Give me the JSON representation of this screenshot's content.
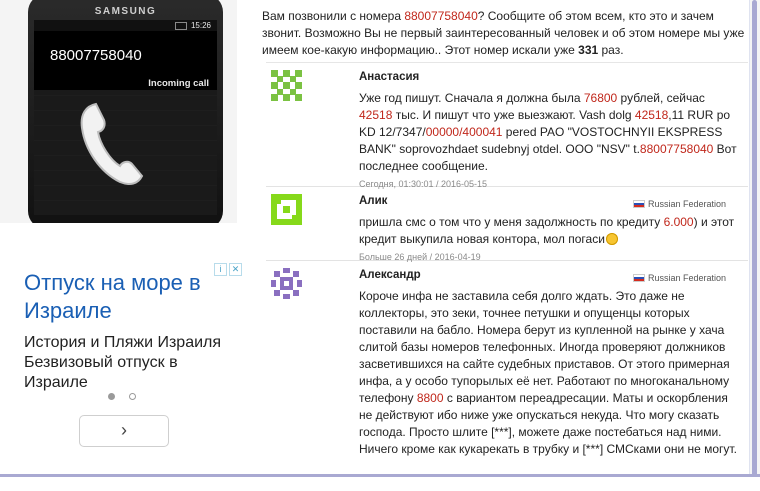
{
  "phone": {
    "brand": "SAMSUNG",
    "time": "15:26",
    "number": "88007758040",
    "status": "Incoming call"
  },
  "ad": {
    "title": "Отпуск на море в Израиле",
    "text": "История и Пляжи Израиля Безвизовый отпуск в Израиле",
    "next_label": "›",
    "dots": [
      {
        "active": true
      },
      {
        "active": false
      }
    ]
  },
  "intro": {
    "before_number": "Вам позвонили с номера ",
    "number": "88007758040",
    "after_number": "? Сообщите об этом всем, кто это и зачем звонит. Возможно Вы не первый заинтересованный человек и об этом номере мы уже имеем кое-какую информацию.. Этот номер искали уже ",
    "search_count": "331",
    "suffix": " раз."
  },
  "comments": [
    {
      "author": "Анастасия",
      "country": "",
      "text_a": "Уже год пишут. Сначала я должна была ",
      "hl1": "76800",
      "text_b": " рублей, сейчас ",
      "hl2": "42518",
      "text_c": " тыс. И пишут что уже выезжают. Vash dolg ",
      "hl3": "42518",
      "text_d": ",11 RUR po KD 12/7347/",
      "hl4": "00000/400041",
      "text_e": " pered PAO \"VOSTOCHNYII EKSPRESS BANK\" soprovozhdaet sudebnyj otdel. OOO \"NSV\" t.",
      "hl5": "88007758040",
      "text_f": " Вот последнее сообщение.",
      "date": "Сегодня, 01:30:01 / 2016-05-15",
      "avatar_color": "#7bc242"
    },
    {
      "author": "Алик",
      "country": "Russian Federation",
      "text_a": "пришла смс о том что у меня задолжность по кредиту ",
      "hl1": "6.000",
      "text_b": ") и этот кредит выкупила новая контора, мол погаси",
      "date": "Больше 26 дней / 2016-04-19",
      "avatar_color": "#86d91a"
    },
    {
      "author": "Александр",
      "country": "Russian Federation",
      "text_a": "Короче инфа не заставила себя долго ждать. Это даже не коллекторы, это зеки, точнее петушки и опущенцы которых поставили на бабло. Номера берут из купленной на рынке у хача слитой базы номеров телефонных. Иногда проверяют должников засветившихся на сайте судебных приставов. От этого примерная инфа, а у особо тупорылых её нет. Работают по многоканальному телефону ",
      "hl1": "8800",
      "text_b": " с вариантом переадресации. Маты и оскорбления не действуют ибо ниже уже опускаться некуда. Что могу сказать господа. Просто шлите [***], можете даже постебаться над ними. Ничего кроме как кукарекать в трубку и [***] СМСками они не могут.",
      "avatar_color": "#8a6fc0"
    }
  ]
}
